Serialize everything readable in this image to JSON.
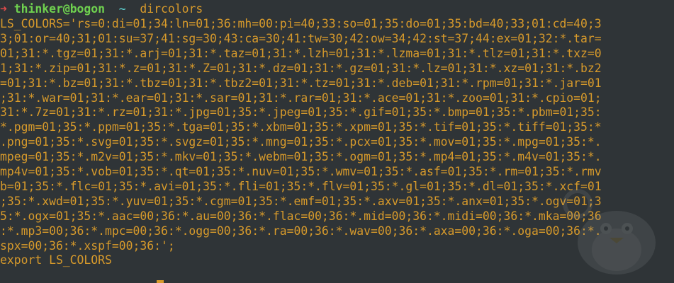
{
  "terminal": {
    "prompt": {
      "arrow": "➜",
      "user_host": "thinker@bogon",
      "dir": "~",
      "command": "dircolors"
    },
    "output_lines": [
      "LS_COLORS='rs=0:di=01;34:ln=01;36:mh=00:pi=40;33:so=01;35:do=01;35:bd=40;33;01:cd=40;3",
      "3;01:or=40;31;01:su=37;41:sg=30;43:ca=30;41:tw=30;42:ow=34;42:st=37;44:ex=01;32:*.tar=",
      "01;31:*.tgz=01;31:*.arj=01;31:*.taz=01;31:*.lzh=01;31:*.lzma=01;31:*.tlz=01;31:*.txz=0",
      "1;31:*.zip=01;31:*.z=01;31:*.Z=01;31:*.dz=01;31:*.gz=01;31:*.lz=01;31:*.xz=01;31:*.bz2",
      "=01;31:*.bz=01;31:*.tbz=01;31:*.tbz2=01;31:*.tz=01;31:*.deb=01;31:*.rpm=01;31:*.jar=01",
      ";31:*.war=01;31:*.ear=01;31:*.sar=01;31:*.rar=01;31:*.ace=01;31:*.zoo=01;31:*.cpio=01;",
      "31:*.7z=01;31:*.rz=01;31:*.jpg=01;35:*.jpeg=01;35:*.gif=01;35:*.bmp=01;35:*.pbm=01;35:",
      "*.pgm=01;35:*.ppm=01;35:*.tga=01;35:*.xbm=01;35:*.xpm=01;35:*.tif=01;35:*.tiff=01;35:*",
      ".png=01;35:*.svg=01;35:*.svgz=01;35:*.mng=01;35:*.pcx=01;35:*.mov=01;35:*.mpg=01;35:*.",
      "mpeg=01;35:*.m2v=01;35:*.mkv=01;35:*.webm=01;35:*.ogm=01;35:*.mp4=01;35:*.m4v=01;35:*.",
      "mp4v=01;35:*.vob=01;35:*.qt=01;35:*.nuv=01;35:*.wmv=01;35:*.asf=01;35:*.rm=01;35:*.rmv",
      "b=01;35:*.flc=01;35:*.avi=01;35:*.fli=01;35:*.flv=01;35:*.gl=01;35:*.dl=01;35:*.xcf=01",
      ";35:*.xwd=01;35:*.yuv=01;35:*.cgm=01;35:*.emf=01;35:*.axv=01;35:*.anx=01;35:*.ogv=01;3",
      "5:*.ogx=01;35:*.aac=00;36:*.au=00;36:*.flac=00;36:*.mid=00;36:*.midi=00;36:*.mka=00;36",
      ":*.mp3=00;36:*.mpc=00;36:*.ogg=00;36:*.ra=00;36:*.wav=00;36:*.axa=00;36:*.oga=00;36:*.",
      "spx=00;36:*.xspf=00;36:';",
      "export LS_COLORS"
    ],
    "colors": {
      "background": "#2f3437",
      "text": "#d79a2b",
      "prompt_arrow": "#e04b4b",
      "prompt_user": "#6fd14f",
      "prompt_dir": "#5fd7d7"
    },
    "watermark_icon": "penguin-logo-icon"
  }
}
